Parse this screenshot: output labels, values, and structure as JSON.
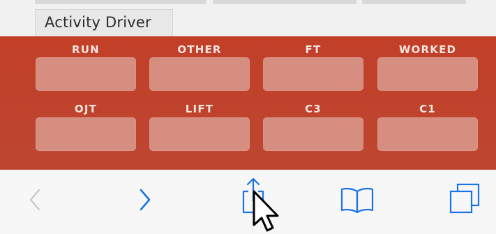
{
  "header": {
    "tab_label": "Activity Driver"
  },
  "panel": {
    "row1": [
      "RUN",
      "OTHER",
      "FT",
      "WORKED"
    ],
    "row1_values": [
      "",
      "",
      "",
      ""
    ],
    "row2": [
      "OJT",
      "LIFT",
      "C3",
      "C1"
    ],
    "row2_values": [
      "",
      "",
      "",
      ""
    ],
    "background_color": "#c0422c"
  },
  "toolbar": {
    "buttons": [
      {
        "name": "back",
        "icon": "chevron-left-icon",
        "enabled": false
      },
      {
        "name": "forward",
        "icon": "chevron-right-icon",
        "enabled": true
      },
      {
        "name": "share",
        "icon": "share-icon",
        "enabled": true
      },
      {
        "name": "bookmarks",
        "icon": "book-icon",
        "enabled": true
      },
      {
        "name": "tabs",
        "icon": "tabs-icon",
        "enabled": true
      }
    ],
    "accent_color": "#1a73e8"
  }
}
